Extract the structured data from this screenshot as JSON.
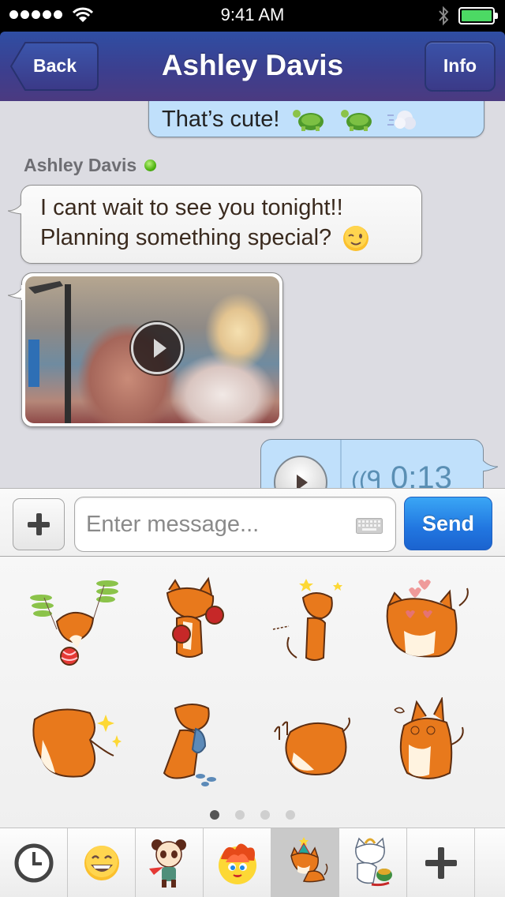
{
  "status_bar": {
    "time": "9:41 AM",
    "signal_bars": 5,
    "battery_level": 1.0,
    "icons": [
      "signal-dots-icon",
      "wifi-icon",
      "bluetooth-icon",
      "battery-icon"
    ]
  },
  "nav": {
    "title": "Ashley Davis",
    "back_label": "Back",
    "info_label": "Info",
    "color": "#3c3f8f"
  },
  "messages": [
    {
      "direction": "outgoing",
      "type": "text",
      "text": "That’s cute!",
      "emoji": [
        "turtle",
        "turtle",
        "dash"
      ]
    },
    {
      "direction": "incoming",
      "sender": "Ashley Davis",
      "sender_online": true
    },
    {
      "direction": "incoming",
      "type": "text",
      "lines": [
        "I cant wait to see you tonight!!",
        "Planning something special?"
      ],
      "emoji": [
        "winking-face"
      ]
    },
    {
      "direction": "incoming",
      "type": "video",
      "thumbnail": "woman-in-sunglasses-in-car"
    },
    {
      "direction": "outgoing",
      "type": "voice",
      "duration": "0:13"
    }
  ],
  "composer": {
    "placeholder": "Enter message...",
    "value": "",
    "send_label": "Send",
    "send_color": "#2176e0"
  },
  "stickers": {
    "pack": "corgi",
    "items": [
      {
        "name": "corgi-propeller-ball"
      },
      {
        "name": "corgi-boxing"
      },
      {
        "name": "corgi-dizzy-stars"
      },
      {
        "name": "corgi-heart-eyes"
      },
      {
        "name": "corgi-sparkle-wink"
      },
      {
        "name": "corgi-blue-toy"
      },
      {
        "name": "corgi-singing"
      },
      {
        "name": "corgi-confused"
      }
    ],
    "pages": 4,
    "current_page": 1
  },
  "tabs": [
    {
      "name": "recent",
      "icon": "clock-icon",
      "selected": false
    },
    {
      "name": "emoji",
      "icon": "smiley-icon",
      "selected": false
    },
    {
      "name": "panda-pack",
      "icon": "panda-sticker-icon",
      "selected": false
    },
    {
      "name": "fire-cat-pack",
      "icon": "fire-cat-sticker-icon",
      "selected": false
    },
    {
      "name": "corgi-pack",
      "icon": "corgi-sticker-icon",
      "selected": true
    },
    {
      "name": "cat-noodles-pack",
      "icon": "cat-sticker-icon",
      "selected": false
    },
    {
      "name": "add-pack",
      "icon": "plus-icon",
      "selected": false
    }
  ]
}
